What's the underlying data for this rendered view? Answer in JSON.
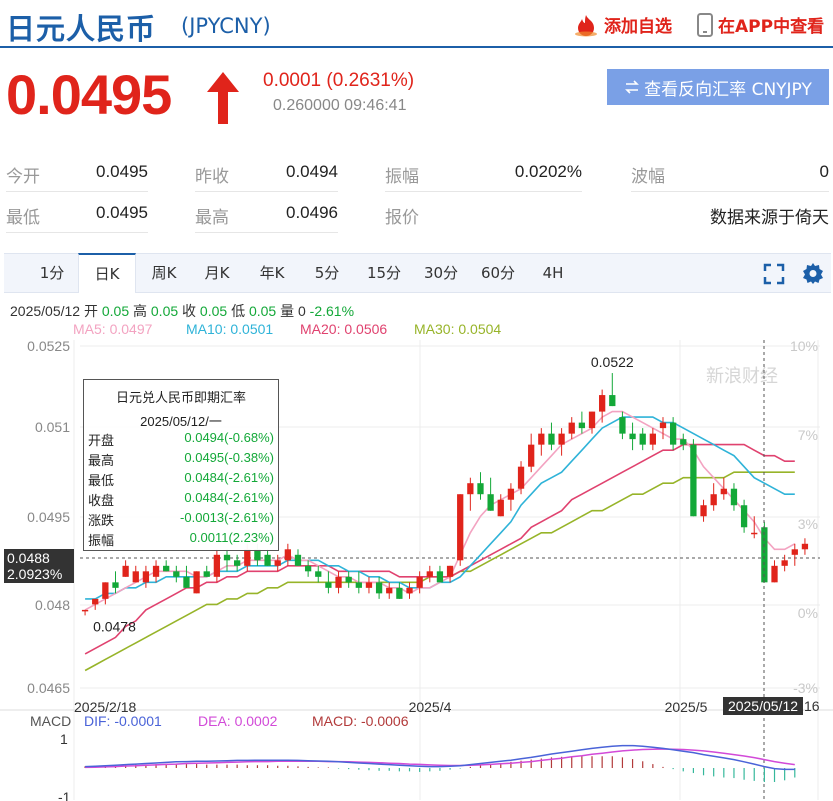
{
  "header": {
    "title": "日元人民币",
    "code": "(JPYCNY)",
    "favorite_label": "添加自选",
    "app_label": "在APP中查看"
  },
  "quote": {
    "price": "0.0495",
    "change": "0.0001 (0.2631%)",
    "sub": "0.260000 09:46:41",
    "reverse_button": "查看反向汇率 CNYJPY",
    "color_up": "#e0241b",
    "color_down": "#13a838"
  },
  "stats": [
    {
      "label": "今开",
      "value": "0.0495"
    },
    {
      "label": "昨收",
      "value": "0.0494"
    },
    {
      "label": "振幅",
      "value": "0.0202%"
    },
    {
      "label": "波幅",
      "value": "0"
    },
    {
      "label": "最低",
      "value": "0.0495"
    },
    {
      "label": "最高",
      "value": "0.0496"
    },
    {
      "label": "报价",
      "value": "数据来源于倚天"
    }
  ],
  "tabs": [
    "1分",
    "日K",
    "周K",
    "月K",
    "年K",
    "5分",
    "15分",
    "30分",
    "60分",
    "4H"
  ],
  "active_tab": "日K",
  "info": {
    "date": "2025/05/12",
    "open_lbl": "开",
    "open": "0.05",
    "high_lbl": "高",
    "high": "0.05",
    "close_lbl": "收",
    "close": "0.05",
    "low_lbl": "低",
    "low": "0.05",
    "vol_lbl": "量",
    "vol": "0",
    "pct": "-2.61%"
  },
  "ma": {
    "ma5": "MA5: 0.0497",
    "ma10": "MA10: 0.0501",
    "ma20": "MA20: 0.0506",
    "ma30": "MA30: 0.0504"
  },
  "axis": {
    "y_labels": [
      "0.0525",
      "0.051",
      "0.0495",
      "0.048",
      "0.0465"
    ],
    "pct_labels": [
      "10%",
      "7%",
      "3%",
      "0%",
      "-3%"
    ],
    "x_labels": [
      "2025/2/18",
      "2025/4",
      "2025/5"
    ],
    "cursor_date": "2025/05/12",
    "cursor_tail": "16",
    "cursor_price": "0.0488",
    "cursor_pct": "2.0923%",
    "max_label": "0.0522",
    "min_label": "0.0478",
    "watermark": "新浪财经"
  },
  "tooltip": {
    "title": "日元兑人民币即期汇率",
    "date": "2025/05/12/一",
    "rows": [
      {
        "label": "开盘",
        "value": "0.0494(-0.68%)"
      },
      {
        "label": "最高",
        "value": "0.0495(-0.38%)"
      },
      {
        "label": "最低",
        "value": "0.0484(-2.61%)"
      },
      {
        "label": "收盘",
        "value": "0.0484(-2.61%)"
      },
      {
        "label": "涨跌",
        "value": "-0.0013(-2.61%)"
      },
      {
        "label": "振幅",
        "value": "0.0011(2.23%)"
      }
    ]
  },
  "macd": {
    "label": "MACD",
    "dif": "DIF: -0.0001",
    "dea": "DEA: 0.0002",
    "macd": "MACD: -0.0006",
    "y_top": "1",
    "y_bottom": "-1"
  },
  "chart_data": {
    "type": "candlestick",
    "y_range": [
      0.0463,
      0.0528
    ],
    "candles": [
      [
        0.0479,
        0.0479,
        0.0478,
        0.0479
      ],
      [
        0.048,
        0.0481,
        0.0479,
        0.0481
      ],
      [
        0.0481,
        0.0484,
        0.048,
        0.0484
      ],
      [
        0.0484,
        0.0486,
        0.0482,
        0.0483
      ],
      [
        0.0485,
        0.0488,
        0.0485,
        0.0487
      ],
      [
        0.0484,
        0.0487,
        0.0484,
        0.0486
      ],
      [
        0.0484,
        0.0487,
        0.0483,
        0.0486
      ],
      [
        0.0485,
        0.0488,
        0.0484,
        0.0487
      ],
      [
        0.0487,
        0.0488,
        0.0486,
        0.0486
      ],
      [
        0.0486,
        0.0487,
        0.0484,
        0.0485
      ],
      [
        0.0485,
        0.0487,
        0.0483,
        0.0483
      ],
      [
        0.0482,
        0.0486,
        0.0482,
        0.0486
      ],
      [
        0.0486,
        0.0487,
        0.0485,
        0.0485
      ],
      [
        0.0485,
        0.049,
        0.0484,
        0.0489
      ],
      [
        0.0489,
        0.049,
        0.0486,
        0.0488
      ],
      [
        0.0488,
        0.0489,
        0.0486,
        0.0487
      ],
      [
        0.0487,
        0.0491,
        0.0486,
        0.049
      ],
      [
        0.049,
        0.0491,
        0.0487,
        0.0488
      ],
      [
        0.0489,
        0.049,
        0.0487,
        0.0487
      ],
      [
        0.0487,
        0.0489,
        0.0486,
        0.0488
      ],
      [
        0.0488,
        0.0491,
        0.0487,
        0.049
      ],
      [
        0.0489,
        0.049,
        0.0487,
        0.0487
      ],
      [
        0.0487,
        0.0488,
        0.0485,
        0.0486
      ],
      [
        0.0486,
        0.0487,
        0.0484,
        0.0485
      ],
      [
        0.0484,
        0.0486,
        0.0482,
        0.0483
      ],
      [
        0.0483,
        0.0486,
        0.0482,
        0.0485
      ],
      [
        0.0485,
        0.0486,
        0.0483,
        0.0484
      ],
      [
        0.0484,
        0.0486,
        0.0482,
        0.0483
      ],
      [
        0.0483,
        0.0485,
        0.0482,
        0.0484
      ],
      [
        0.0484,
        0.0485,
        0.0481,
        0.0482
      ],
      [
        0.0482,
        0.0484,
        0.0481,
        0.0483
      ],
      [
        0.0483,
        0.0484,
        0.0481,
        0.0481
      ],
      [
        0.0482,
        0.0484,
        0.0481,
        0.0483
      ],
      [
        0.0483,
        0.0486,
        0.0482,
        0.0485
      ],
      [
        0.0485,
        0.0487,
        0.0484,
        0.0486
      ],
      [
        0.0486,
        0.0487,
        0.0484,
        0.0484
      ],
      [
        0.0485,
        0.0487,
        0.0484,
        0.0487
      ],
      [
        0.0488,
        0.05,
        0.0487,
        0.05
      ],
      [
        0.05,
        0.0503,
        0.0497,
        0.0502
      ],
      [
        0.0502,
        0.0504,
        0.0499,
        0.05
      ],
      [
        0.05,
        0.0503,
        0.0497,
        0.0497
      ],
      [
        0.0496,
        0.05,
        0.0496,
        0.0499
      ],
      [
        0.0499,
        0.0502,
        0.0497,
        0.0501
      ],
      [
        0.0501,
        0.0506,
        0.05,
        0.0505
      ],
      [
        0.0505,
        0.0511,
        0.0504,
        0.0509
      ],
      [
        0.0509,
        0.0512,
        0.0507,
        0.0511
      ],
      [
        0.0511,
        0.0513,
        0.0508,
        0.0509
      ],
      [
        0.0509,
        0.0512,
        0.0507,
        0.0511
      ],
      [
        0.0511,
        0.0514,
        0.051,
        0.0513
      ],
      [
        0.0513,
        0.0515,
        0.0511,
        0.0512
      ],
      [
        0.0512,
        0.0515,
        0.0511,
        0.0515
      ],
      [
        0.0515,
        0.0519,
        0.0513,
        0.0518
      ],
      [
        0.0518,
        0.0522,
        0.0516,
        0.0516
      ],
      [
        0.0514,
        0.0515,
        0.051,
        0.0511
      ],
      [
        0.0511,
        0.0513,
        0.0508,
        0.051
      ],
      [
        0.0511,
        0.0512,
        0.0508,
        0.0509
      ],
      [
        0.0509,
        0.0512,
        0.0508,
        0.0511
      ],
      [
        0.0512,
        0.0514,
        0.051,
        0.0513
      ],
      [
        0.0513,
        0.0514,
        0.0508,
        0.0509
      ],
      [
        0.051,
        0.0511,
        0.0508,
        0.0509
      ],
      [
        0.0509,
        0.051,
        0.0496,
        0.0496
      ],
      [
        0.0496,
        0.0499,
        0.0495,
        0.0498
      ],
      [
        0.0498,
        0.0502,
        0.0497,
        0.05
      ],
      [
        0.05,
        0.0503,
        0.0499,
        0.0501
      ],
      [
        0.0501,
        0.0502,
        0.0497,
        0.0498
      ],
      [
        0.0498,
        0.0499,
        0.0493,
        0.0494
      ],
      [
        0.0493,
        0.0496,
        0.0492,
        0.0493
      ],
      [
        0.0494,
        0.0495,
        0.0484,
        0.0484
      ],
      [
        0.0484,
        0.0488,
        0.0484,
        0.0487
      ],
      [
        0.0487,
        0.0489,
        0.0486,
        0.0488
      ],
      [
        0.0489,
        0.0491,
        0.0487,
        0.049
      ],
      [
        0.049,
        0.0492,
        0.0489,
        0.0491
      ]
    ],
    "ma5": [
      0.0479,
      0.048,
      0.0481,
      0.0482,
      0.0483,
      0.0484,
      0.0485,
      0.0486,
      0.0486,
      0.0486,
      0.0486,
      0.0485,
      0.0485,
      0.0486,
      0.0487,
      0.0487,
      0.0488,
      0.0488,
      0.0488,
      0.0488,
      0.0489,
      0.0488,
      0.0488,
      0.0487,
      0.0486,
      0.0485,
      0.0485,
      0.0484,
      0.0484,
      0.0484,
      0.0483,
      0.0483,
      0.0482,
      0.0483,
      0.0483,
      0.0484,
      0.0485,
      0.0489,
      0.0493,
      0.0496,
      0.0498,
      0.0499,
      0.05,
      0.0501,
      0.0503,
      0.0505,
      0.0507,
      0.0509,
      0.051,
      0.0511,
      0.0512,
      0.0514,
      0.0515,
      0.0515,
      0.0514,
      0.0513,
      0.0512,
      0.0511,
      0.051,
      0.051,
      0.0508,
      0.0505,
      0.0503,
      0.0501,
      0.0499,
      0.0497,
      0.0495,
      0.0492,
      0.049,
      0.049,
      0.0491
    ],
    "ma10": [
      0.0481,
      0.0481,
      0.0482,
      0.0482,
      0.0483,
      0.0483,
      0.0484,
      0.0484,
      0.0485,
      0.0485,
      0.0485,
      0.0485,
      0.0485,
      0.0486,
      0.0486,
      0.0486,
      0.0487,
      0.0487,
      0.0487,
      0.0487,
      0.0488,
      0.0488,
      0.0488,
      0.0488,
      0.0487,
      0.0487,
      0.0486,
      0.0486,
      0.0485,
      0.0485,
      0.0484,
      0.0484,
      0.0483,
      0.0483,
      0.0483,
      0.0484,
      0.0484,
      0.0485,
      0.0487,
      0.0489,
      0.0491,
      0.0493,
      0.0495,
      0.0498,
      0.05,
      0.0502,
      0.0503,
      0.0504,
      0.0506,
      0.0508,
      0.051,
      0.0512,
      0.0513,
      0.0514,
      0.0514,
      0.0514,
      0.0514,
      0.0513,
      0.0513,
      0.0512,
      0.0511,
      0.051,
      0.0509,
      0.0508,
      0.0507,
      0.0505,
      0.0503,
      0.0502,
      0.0501,
      0.05,
      0.05
    ],
    "ma20": [
      0.0471,
      0.0472,
      0.0473,
      0.0474,
      0.0476,
      0.0477,
      0.0479,
      0.048,
      0.0481,
      0.0482,
      0.0483,
      0.0483,
      0.0484,
      0.0484,
      0.0485,
      0.0485,
      0.0486,
      0.0486,
      0.0486,
      0.0486,
      0.0487,
      0.0487,
      0.0487,
      0.0487,
      0.0487,
      0.0486,
      0.0486,
      0.0486,
      0.0486,
      0.0486,
      0.0486,
      0.0485,
      0.0485,
      0.0485,
      0.0485,
      0.0485,
      0.0485,
      0.0486,
      0.0487,
      0.0488,
      0.0489,
      0.049,
      0.0491,
      0.0492,
      0.0494,
      0.0495,
      0.0496,
      0.0497,
      0.0499,
      0.05,
      0.0501,
      0.0502,
      0.0503,
      0.0504,
      0.0505,
      0.0506,
      0.0507,
      0.0508,
      0.0508,
      0.0509,
      0.0509,
      0.0509,
      0.0509,
      0.0509,
      0.0509,
      0.0509,
      0.0508,
      0.0507,
      0.0507,
      0.0506,
      0.0506
    ],
    "ma30": [
      0.0468,
      0.0469,
      0.047,
      0.0471,
      0.0472,
      0.0473,
      0.0474,
      0.0475,
      0.0476,
      0.0477,
      0.0478,
      0.0479,
      0.048,
      0.048,
      0.0481,
      0.0481,
      0.0482,
      0.0482,
      0.0483,
      0.0483,
      0.0484,
      0.0484,
      0.0484,
      0.0484,
      0.0484,
      0.0484,
      0.0484,
      0.0484,
      0.0484,
      0.0484,
      0.0484,
      0.0484,
      0.0484,
      0.0484,
      0.0485,
      0.0485,
      0.0485,
      0.0486,
      0.0486,
      0.0487,
      0.0488,
      0.0489,
      0.049,
      0.0491,
      0.0492,
      0.0493,
      0.0493,
      0.0494,
      0.0495,
      0.0496,
      0.0497,
      0.0497,
      0.0498,
      0.0499,
      0.05,
      0.05,
      0.0501,
      0.0502,
      0.0502,
      0.0503,
      0.0503,
      0.0503,
      0.0503,
      0.0503,
      0.0504,
      0.0504,
      0.0504,
      0.0504,
      0.0504,
      0.0504,
      0.0504
    ],
    "macd_range": [
      -1,
      1
    ],
    "dif": [
      0.05,
      0.06,
      0.08,
      0.1,
      0.12,
      0.14,
      0.16,
      0.18,
      0.2,
      0.22,
      0.23,
      0.24,
      0.24,
      0.25,
      0.26,
      0.27,
      0.27,
      0.28,
      0.28,
      0.28,
      0.28,
      0.27,
      0.26,
      0.25,
      0.24,
      0.22,
      0.2,
      0.18,
      0.16,
      0.14,
      0.12,
      0.1,
      0.08,
      0.06,
      0.05,
      0.05,
      0.06,
      0.08,
      0.12,
      0.16,
      0.2,
      0.24,
      0.28,
      0.33,
      0.38,
      0.44,
      0.5,
      0.55,
      0.6,
      0.65,
      0.7,
      0.74,
      0.78,
      0.8,
      0.8,
      0.78,
      0.74,
      0.7,
      0.65,
      0.6,
      0.55,
      0.48,
      0.42,
      0.36,
      0.3,
      0.22,
      0.14,
      0.05,
      -0.02,
      -0.05,
      -0.05
    ],
    "dea": [
      0.02,
      0.03,
      0.04,
      0.05,
      0.07,
      0.08,
      0.1,
      0.11,
      0.13,
      0.14,
      0.16,
      0.17,
      0.18,
      0.19,
      0.2,
      0.21,
      0.22,
      0.23,
      0.23,
      0.24,
      0.24,
      0.24,
      0.24,
      0.24,
      0.23,
      0.23,
      0.22,
      0.21,
      0.2,
      0.19,
      0.17,
      0.16,
      0.14,
      0.13,
      0.11,
      0.1,
      0.09,
      0.09,
      0.1,
      0.11,
      0.13,
      0.15,
      0.17,
      0.2,
      0.23,
      0.27,
      0.31,
      0.35,
      0.4,
      0.44,
      0.49,
      0.53,
      0.57,
      0.61,
      0.64,
      0.66,
      0.67,
      0.68,
      0.67,
      0.66,
      0.64,
      0.61,
      0.57,
      0.53,
      0.48,
      0.43,
      0.37,
      0.3,
      0.23,
      0.17,
      0.12
    ]
  }
}
